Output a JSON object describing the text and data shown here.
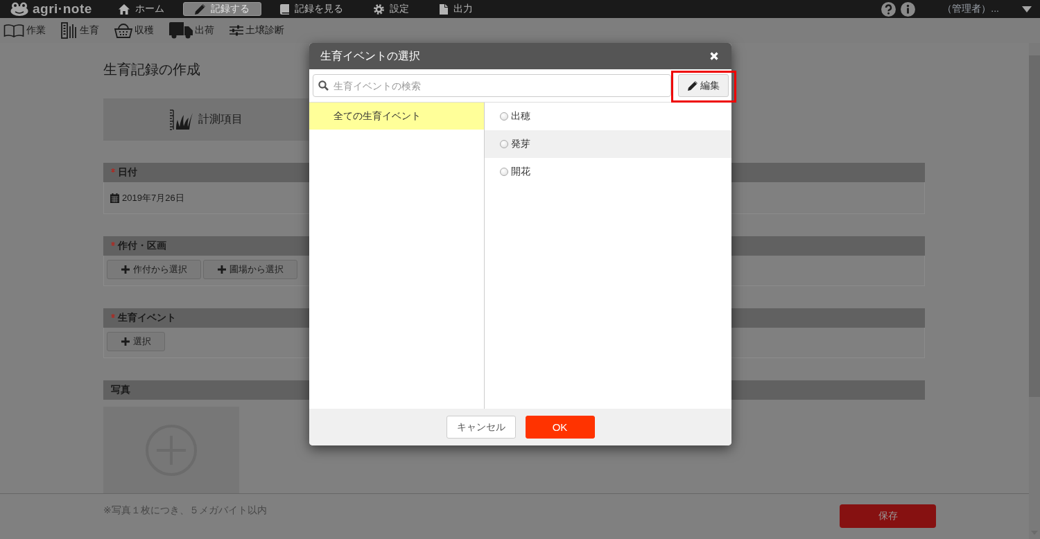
{
  "top_nav": {
    "logo": "agri·note",
    "items": [
      {
        "label": "ホーム",
        "selected": false
      },
      {
        "label": "記録する",
        "selected": true
      },
      {
        "label": "記録を見る",
        "selected": false
      },
      {
        "label": "設定",
        "selected": false
      },
      {
        "label": "出力",
        "selected": false
      }
    ],
    "user": "（管理者）..."
  },
  "sub_nav": {
    "items": [
      {
        "label": "作業"
      },
      {
        "label": "生育"
      },
      {
        "label": "収穫"
      },
      {
        "label": "出荷"
      },
      {
        "label": "土壌診断"
      }
    ]
  },
  "page": {
    "title": "生育記録の作成",
    "tiles": [
      {
        "label": "計測項目"
      }
    ],
    "sections": [
      {
        "kind": "date",
        "title": "日付",
        "required": true,
        "value": "2019年7月26日"
      },
      {
        "kind": "buttons",
        "title": "作付・区画",
        "required": true,
        "buttons": [
          "作付から選択",
          "圃場から選択"
        ]
      },
      {
        "kind": "buttons",
        "title": "生育イベント",
        "required": true,
        "buttons": [
          "選択"
        ]
      },
      {
        "kind": "photo",
        "title": "写真",
        "required": false
      }
    ]
  },
  "footer": {
    "note": "※写真１枚につき、５メガバイト以内",
    "save_button": "保存"
  },
  "dialog": {
    "title": "生育イベントの選択",
    "search": {
      "placeholder": "生育イベントの検索"
    },
    "edit_button": {
      "label": "編集",
      "highlighted": true
    },
    "categories": [
      {
        "label": "全ての生育イベント",
        "selected": true
      }
    ],
    "events": [
      {
        "label": "出穂",
        "selected": false,
        "hovered": false
      },
      {
        "label": "発芽",
        "selected": false,
        "hovered": true
      },
      {
        "label": "開花",
        "selected": false,
        "hovered": false
      }
    ],
    "buttons": [
      {
        "label": "キャンセル",
        "kind": "secondary"
      },
      {
        "label": "OK",
        "kind": "primary"
      }
    ]
  }
}
